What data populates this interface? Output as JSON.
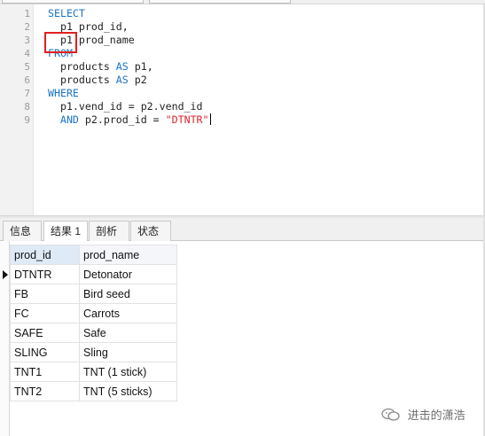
{
  "editor": {
    "line_numbers": [
      "1",
      "2",
      "3",
      "4",
      "5",
      "6",
      "7",
      "8",
      "9"
    ],
    "lines": [
      [
        {
          "t": "SELECT",
          "c": "kw"
        }
      ],
      [
        {
          "t": "  p1 prod_id,",
          "c": ""
        }
      ],
      [
        {
          "t": "  p1 prod_name",
          "c": ""
        }
      ],
      [
        {
          "t": "FROM",
          "c": "kw"
        }
      ],
      [
        {
          "t": "  products ",
          "c": ""
        },
        {
          "t": "AS",
          "c": "kw"
        },
        {
          "t": " p1,",
          "c": ""
        }
      ],
      [
        {
          "t": "  products ",
          "c": ""
        },
        {
          "t": "AS",
          "c": "kw"
        },
        {
          "t": " p2",
          "c": ""
        }
      ],
      [
        {
          "t": "WHERE",
          "c": "kw"
        }
      ],
      [
        {
          "t": "  p1.vend_id = p2.vend_id",
          "c": ""
        }
      ],
      [
        {
          "t": "  ",
          "c": ""
        },
        {
          "t": "AND",
          "c": "kw"
        },
        {
          "t": " p2.prod_id = ",
          "c": ""
        },
        {
          "t": "\"DTNTR\"",
          "c": "str"
        }
      ]
    ],
    "highlight_color": "#e0201f"
  },
  "tabs": {
    "info": "信息",
    "result": "结果 1",
    "profile": "剖析",
    "status": "状态",
    "active": "result"
  },
  "grid": {
    "columns": [
      "prod_id",
      "prod_name"
    ],
    "rows": [
      [
        "DTNTR",
        "Detonator"
      ],
      [
        "FB",
        "Bird seed"
      ],
      [
        "FC",
        "Carrots"
      ],
      [
        "SAFE",
        "Safe"
      ],
      [
        "SLING",
        "Sling"
      ],
      [
        "TNT1",
        "TNT (1 stick)"
      ],
      [
        "TNT2",
        "TNT (5 sticks)"
      ]
    ],
    "current_row": 0
  },
  "watermark": {
    "text": "进击的潇浩",
    "icon": "wechat-icon"
  },
  "colors": {
    "keyword": "#1a73c7",
    "string": "#d5272f"
  }
}
